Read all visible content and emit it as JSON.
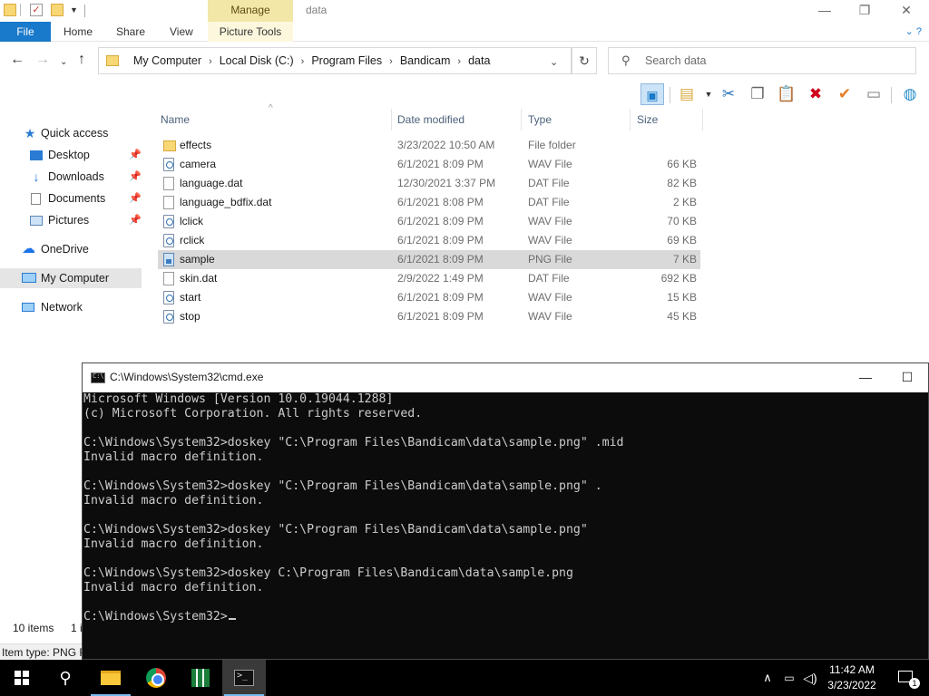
{
  "titlebar": {
    "manage_label": "Manage",
    "window_title": "data",
    "minimize": "—",
    "maximize": "❐",
    "close": "✕"
  },
  "ribbon": {
    "file": "File",
    "tabs": [
      "Home",
      "Share",
      "View"
    ],
    "picture_tools": "Picture Tools",
    "help_icons": "⌄  ?"
  },
  "address": {
    "crumbs": [
      "My Computer",
      "Local Disk (C:)",
      "Program Files",
      "Bandicam",
      "data"
    ],
    "search_placeholder": "Search data"
  },
  "toolbar": {
    "icons": [
      "layout-pane-icon",
      "new-folder-icon",
      "cut-icon",
      "copy-icon",
      "paste-icon",
      "delete-icon",
      "checkmark-icon",
      "rename-icon",
      "globe-icon"
    ]
  },
  "navpane": {
    "quick_access": "Quick access",
    "items": [
      {
        "label": "Desktop",
        "icon": "desktop-icon",
        "pinned": true
      },
      {
        "label": "Downloads",
        "icon": "downloads-icon",
        "pinned": true
      },
      {
        "label": "Documents",
        "icon": "documents-icon",
        "pinned": true
      },
      {
        "label": "Pictures",
        "icon": "pictures-icon",
        "pinned": true
      }
    ],
    "onedrive": "OneDrive",
    "my_computer": "My Computer",
    "network": "Network"
  },
  "columns": {
    "name": "Name",
    "date": "Date modified",
    "type": "Type",
    "size": "Size"
  },
  "files": [
    {
      "name": "effects",
      "date": "3/23/2022 10:50 AM",
      "type": "File folder",
      "size": "",
      "kind": "folder"
    },
    {
      "name": "camera",
      "date": "6/1/2021 8:09 PM",
      "type": "WAV File",
      "size": "66 KB",
      "kind": "wav"
    },
    {
      "name": "language.dat",
      "date": "12/30/2021 3:37 PM",
      "type": "DAT File",
      "size": "82 KB",
      "kind": "dat"
    },
    {
      "name": "language_bdfix.dat",
      "date": "6/1/2021 8:08 PM",
      "type": "DAT File",
      "size": "2 KB",
      "kind": "dat"
    },
    {
      "name": "lclick",
      "date": "6/1/2021 8:09 PM",
      "type": "WAV File",
      "size": "70 KB",
      "kind": "wav"
    },
    {
      "name": "rclick",
      "date": "6/1/2021 8:09 PM",
      "type": "WAV File",
      "size": "69 KB",
      "kind": "wav"
    },
    {
      "name": "sample",
      "date": "6/1/2021 8:09 PM",
      "type": "PNG File",
      "size": "7 KB",
      "kind": "png",
      "selected": true
    },
    {
      "name": "skin.dat",
      "date": "2/9/2022 1:49 PM",
      "type": "DAT File",
      "size": "692 KB",
      "kind": "dat"
    },
    {
      "name": "start",
      "date": "6/1/2021 8:09 PM",
      "type": "WAV File",
      "size": "15 KB",
      "kind": "wav"
    },
    {
      "name": "stop",
      "date": "6/1/2021 8:09 PM",
      "type": "WAV File",
      "size": "45 KB",
      "kind": "wav"
    }
  ],
  "status": {
    "item_count": "10 items",
    "selected_fragment": "1 i",
    "item_type": "Item type: PNG F"
  },
  "cmd": {
    "title": "C:\\Windows\\System32\\cmd.exe",
    "minimize": "—",
    "maximize": "☐",
    "lines": [
      "Microsoft Windows [Version 10.0.19044.1288]",
      "(c) Microsoft Corporation. All rights reserved.",
      "",
      "C:\\Windows\\System32>doskey \"C:\\Program Files\\Bandicam\\data\\sample.png\" .mid",
      "Invalid macro definition.",
      "",
      "C:\\Windows\\System32>doskey \"C:\\Program Files\\Bandicam\\data\\sample.png\" .",
      "Invalid macro definition.",
      "",
      "C:\\Windows\\System32>doskey \"C:\\Program Files\\Bandicam\\data\\sample.png\"",
      "Invalid macro definition.",
      "",
      "C:\\Windows\\System32>doskey C:\\Program Files\\Bandicam\\data\\sample.png",
      "Invalid macro definition.",
      ""
    ],
    "prompt": "C:\\Windows\\System32>"
  },
  "taskbar": {
    "time": "11:42 AM",
    "date": "3/23/2022",
    "notification_count": "1"
  }
}
